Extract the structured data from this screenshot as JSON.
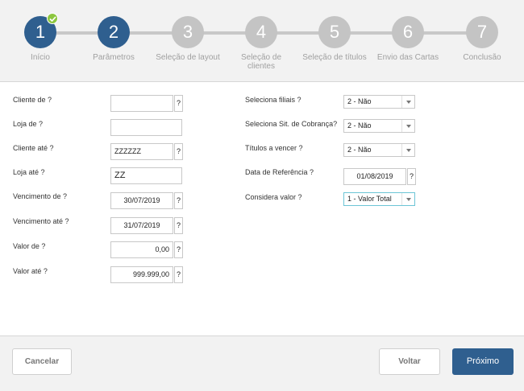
{
  "wizard": {
    "steps": [
      {
        "number": "1",
        "label": "Início"
      },
      {
        "number": "2",
        "label": "Parâmetros"
      },
      {
        "number": "3",
        "label": "Seleção de layout"
      },
      {
        "number": "4",
        "label": "Seleção de clientes"
      },
      {
        "number": "5",
        "label": "Seleção de títulos"
      },
      {
        "number": "6",
        "label": "Envio das Cartas"
      },
      {
        "number": "7",
        "label": "Conclusão"
      }
    ],
    "active_color": "#2f5f8f",
    "inactive_color": "#c4c4c4",
    "completed_check_color": "#8cc63f"
  },
  "left_form": {
    "fields": [
      {
        "label": "Cliente de ?",
        "value": "",
        "help": "?"
      },
      {
        "label": "Loja de ?",
        "value": "",
        "help": ""
      },
      {
        "label": "Cliente até ?",
        "value": "ZZZZZZ",
        "help": "?"
      },
      {
        "label": "Loja até ?",
        "value": "ZZ",
        "help": ""
      },
      {
        "label": "Vencimento de ?",
        "value": "30/07/2019",
        "help": "?"
      },
      {
        "label": "Vencimento até ?",
        "value": "31/07/2019",
        "help": "?"
      },
      {
        "label": "Valor de ?",
        "value": "0,00",
        "help": "?"
      },
      {
        "label": "Valor até ?",
        "value": "999.999,00",
        "help": "?"
      }
    ]
  },
  "right_form": {
    "fields": [
      {
        "label": "Seleciona filiais ?",
        "value": "2 - Não"
      },
      {
        "label": "Seleciona Sit. de Cobrança?",
        "value": "2 - Não"
      },
      {
        "label": "Títulos a vencer ?",
        "value": "2 - Não"
      },
      {
        "label": "Data de Referência ?",
        "value": "01/08/2019",
        "help": "?"
      },
      {
        "label": "Considera valor ?",
        "value": "1 - Valor Total"
      }
    ]
  },
  "footer": {
    "cancel_label": "Cancelar",
    "back_label": "Voltar",
    "next_label": "Próximo"
  }
}
